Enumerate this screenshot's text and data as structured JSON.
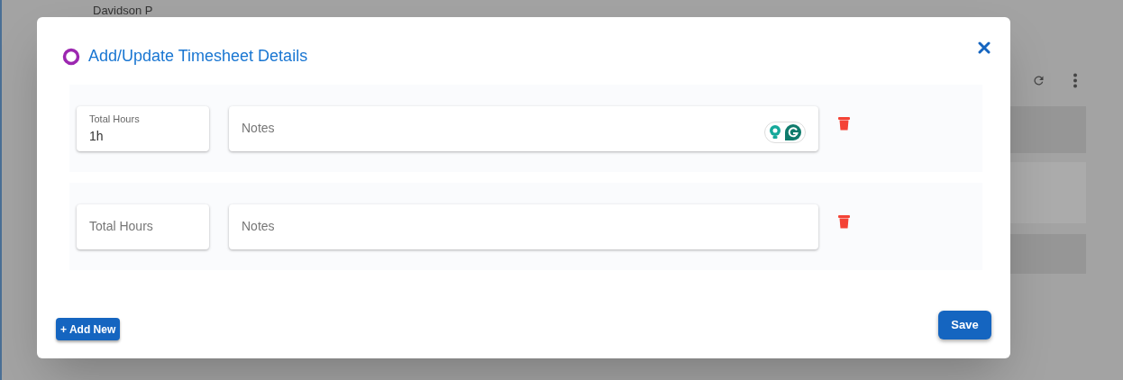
{
  "background": {
    "name": "Davidson P"
  },
  "dialog": {
    "title": "Add/Update Timesheet Details",
    "rows": [
      {
        "hours_label": "Total Hours",
        "hours_value": "1h",
        "notes_placeholder": "Notes",
        "assistant_badge": true
      },
      {
        "hours_placeholder": "Total Hours",
        "notes_placeholder": "Notes",
        "assistant_badge": false
      }
    ],
    "add_button": "+ Add New",
    "save_button": "Save"
  }
}
